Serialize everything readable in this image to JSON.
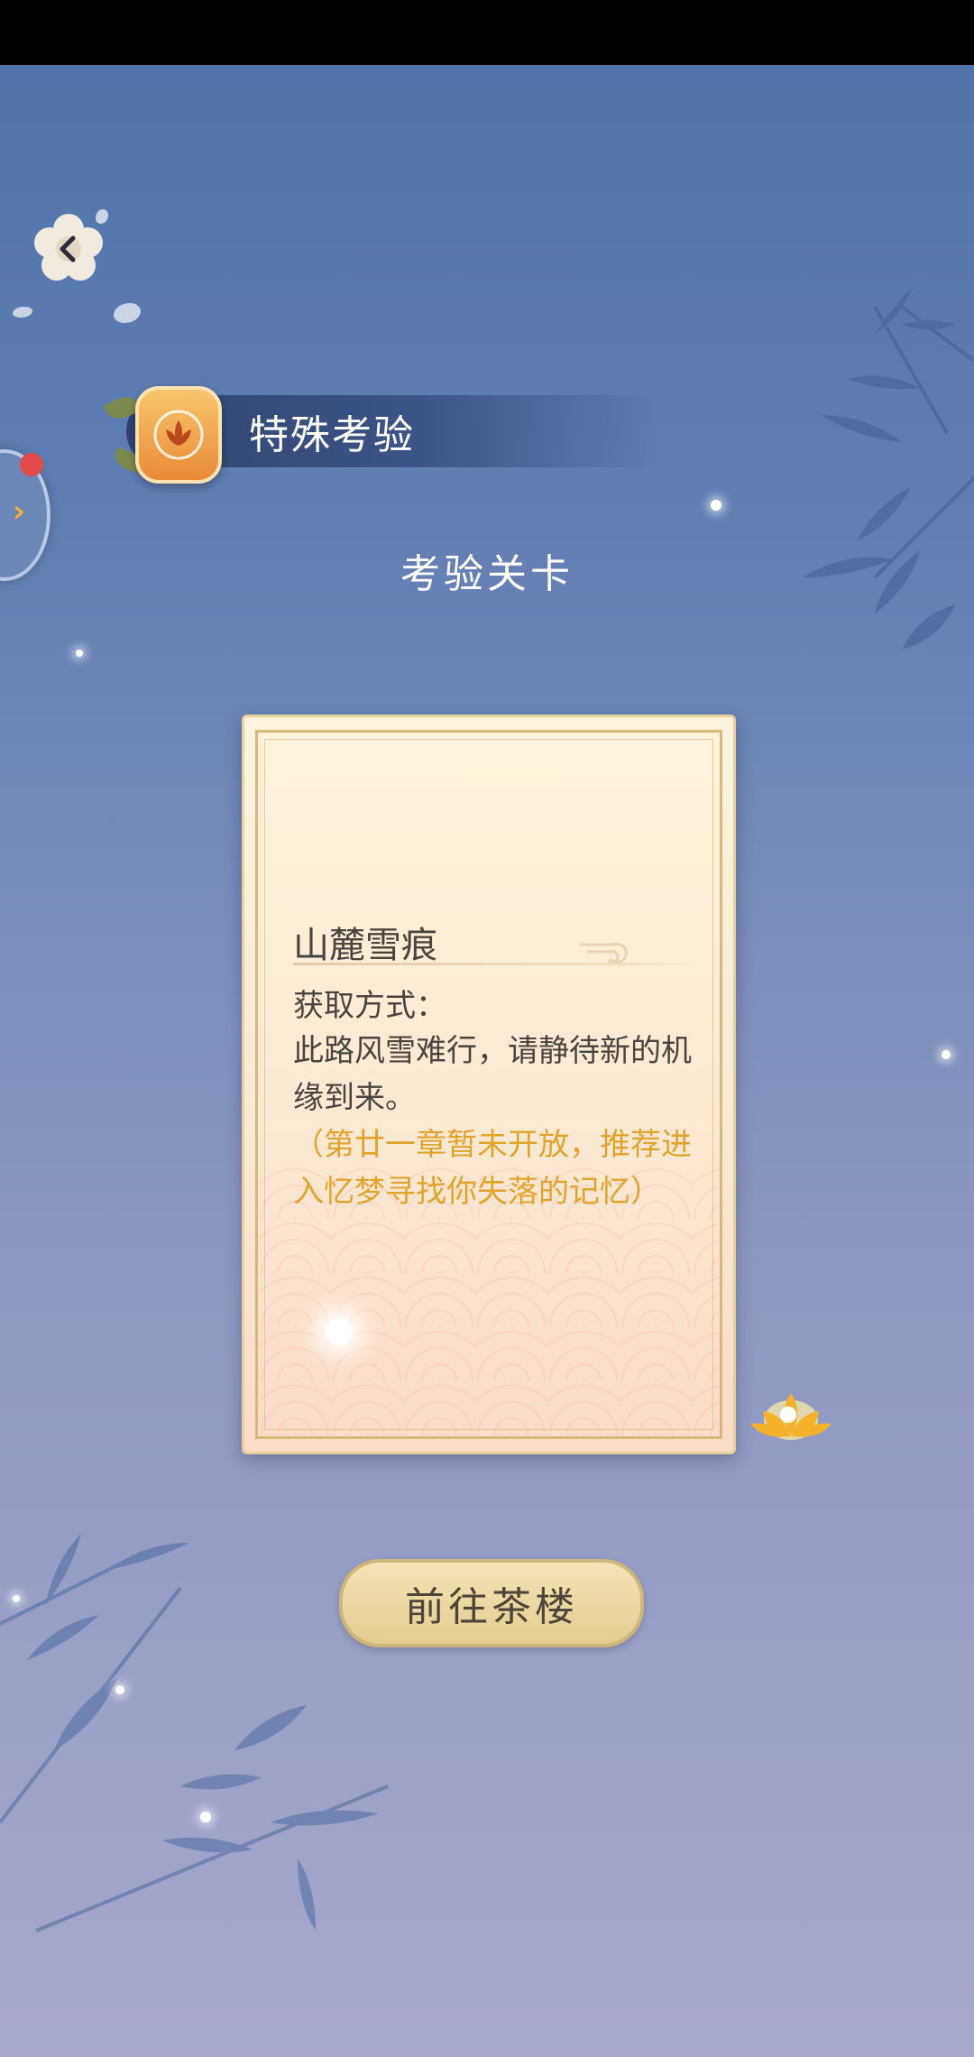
{
  "header": {
    "section_title": "特殊考验",
    "subtitle": "考验关卡"
  },
  "card": {
    "title": "山麓雪痕",
    "acquire_label": "获取方式：",
    "description": "此路风雪难行，请静待新的机缘到来。",
    "hint": "（第廿一章暂未开放，推荐进入忆梦寻找你失落的记忆）"
  },
  "buttons": {
    "goto_teahouse": "前往茶楼"
  },
  "icons": {
    "back": "flower-back-icon",
    "side_toggle": "chevron-right-icon",
    "emblem": "lotus-emblem-icon",
    "lotus_lantern": "golden-lotus-icon"
  },
  "colors": {
    "accent_gold": "#e0a42c",
    "card_text": "#4a4440",
    "notify": "#e34a4a"
  }
}
